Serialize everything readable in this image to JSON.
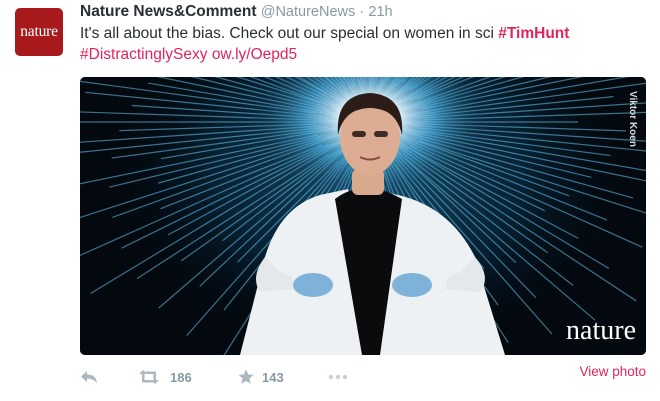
{
  "tweet": {
    "avatar_text": "nature",
    "display_name": "Nature News&Comment",
    "handle": "@NatureNews",
    "separator": "·",
    "time": "21h",
    "text_part1": "It's all about the bias. Check out our special on women in sci ",
    "hashtag1": "#TimHunt",
    "hashtag2": "#DistractinglySexy",
    "link": "ow.ly/Oepd5"
  },
  "media": {
    "photo_credit": "Viktor Koen",
    "wordmark": "nature"
  },
  "actions": {
    "reply_icon": "reply-icon",
    "retweet_icon": "retweet-icon",
    "retweet_count": "186",
    "favorite_icon": "star-icon",
    "favorite_count": "143",
    "more_icon": "more-dots-icon",
    "view_photo_label": "View photo"
  },
  "colors": {
    "brand_red": "#a8191c",
    "hashtag": "#e0245e",
    "muted": "#8899a6",
    "icon": "#aab8c2"
  }
}
